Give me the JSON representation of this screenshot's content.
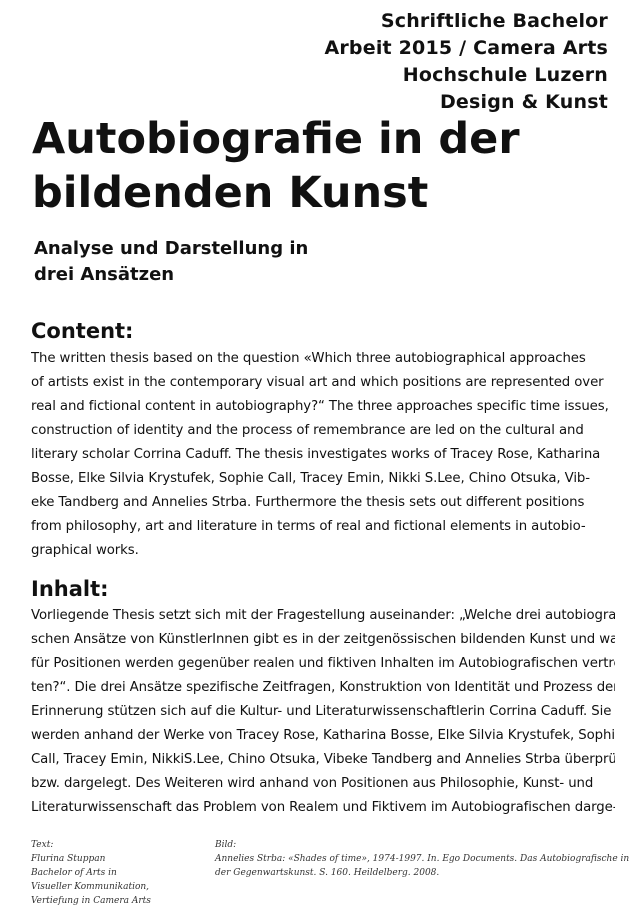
{
  "header": {
    "lines": [
      "Schriftliche Bachelor",
      "Arbeit 2015 / Camera Arts",
      "Hochschule Luzern",
      "Design & Kunst"
    ]
  },
  "title": {
    "lines": [
      "Autobiografie in der",
      "bildenden Kunst"
    ]
  },
  "subtitle": {
    "lines": [
      "Analyse und Darstellung in",
      "drei Ansätzen"
    ]
  },
  "content": {
    "heading": "Content:",
    "lines": [
      "The written thesis based on the question «Which three autobiographical approaches",
      "of artists exist in the contemporary visual art and which positions are represented over",
      "real and fictional content in autobiography?“ The three approaches specific time issues,",
      "construction of identity and the process of remembrance are led on the cultural and",
      "literary scholar Corrina Caduff. The thesis investigates works of Tracey Rose, Katharina",
      "Bosse, Elke Silvia Krystufek, Sophie Call, Tracey Emin, Nikki S.Lee, Chino Otsuka, Vib-",
      "eke Tandberg and Annelies Strba. Furthermore the thesis sets out different positions",
      "from philosophy, art and literature in terms of real and fictional elements in autobio-",
      "graphical works."
    ]
  },
  "inhalt": {
    "heading": "Inhalt:",
    "lines": [
      "Vorliegende Thesis setzt sich mit der Fragestellung auseinander: „Welche drei autobiografi-",
      "schen Ansätze von KünstlerInnen gibt es in der zeitgenössischen bildenden Kunst und was",
      "für Positionen werden gegenüber realen und fiktiven Inhalten im Autobiografischen vertre-",
      "ten?“. Die drei Ansätze spezifische Zeitfragen, Konstruktion von Identität und Prozess der",
      "Erinnerung stützen sich auf die Kultur- und Literaturwissenschaftlerin Corrina Caduff. Sie",
      "werden anhand der Werke von Tracey Rose, Katharina Bosse, Elke Silvia Krystufek, Sophie",
      "Call, Tracey Emin, NikkiS.Lee, Chino Otsuka, Vibeke Tandberg and Annelies Strba überprüft",
      "bzw. dargelegt. Des Weiteren wird anhand von Positionen aus Philosophie, Kunst- und",
      "Literaturwissenschaft das Problem von Realem und Fiktivem im Autobiografischen darge-"
    ]
  },
  "footer": {
    "text_label": "Text:",
    "text_lines": [
      "Flurina Stuppan",
      "Bachelor of Arts in",
      "Visueller Kommunikation,",
      "Vertiefung in Camera Arts"
    ],
    "image_label": "Bild:",
    "image_lines": [
      "Annelies Strba: «Shades of time», 1974-1997. In. Ego Documents. Das Autobiografische in",
      "der Gegenwartskunst. S. 160. Heildelberg. 2008."
    ]
  }
}
